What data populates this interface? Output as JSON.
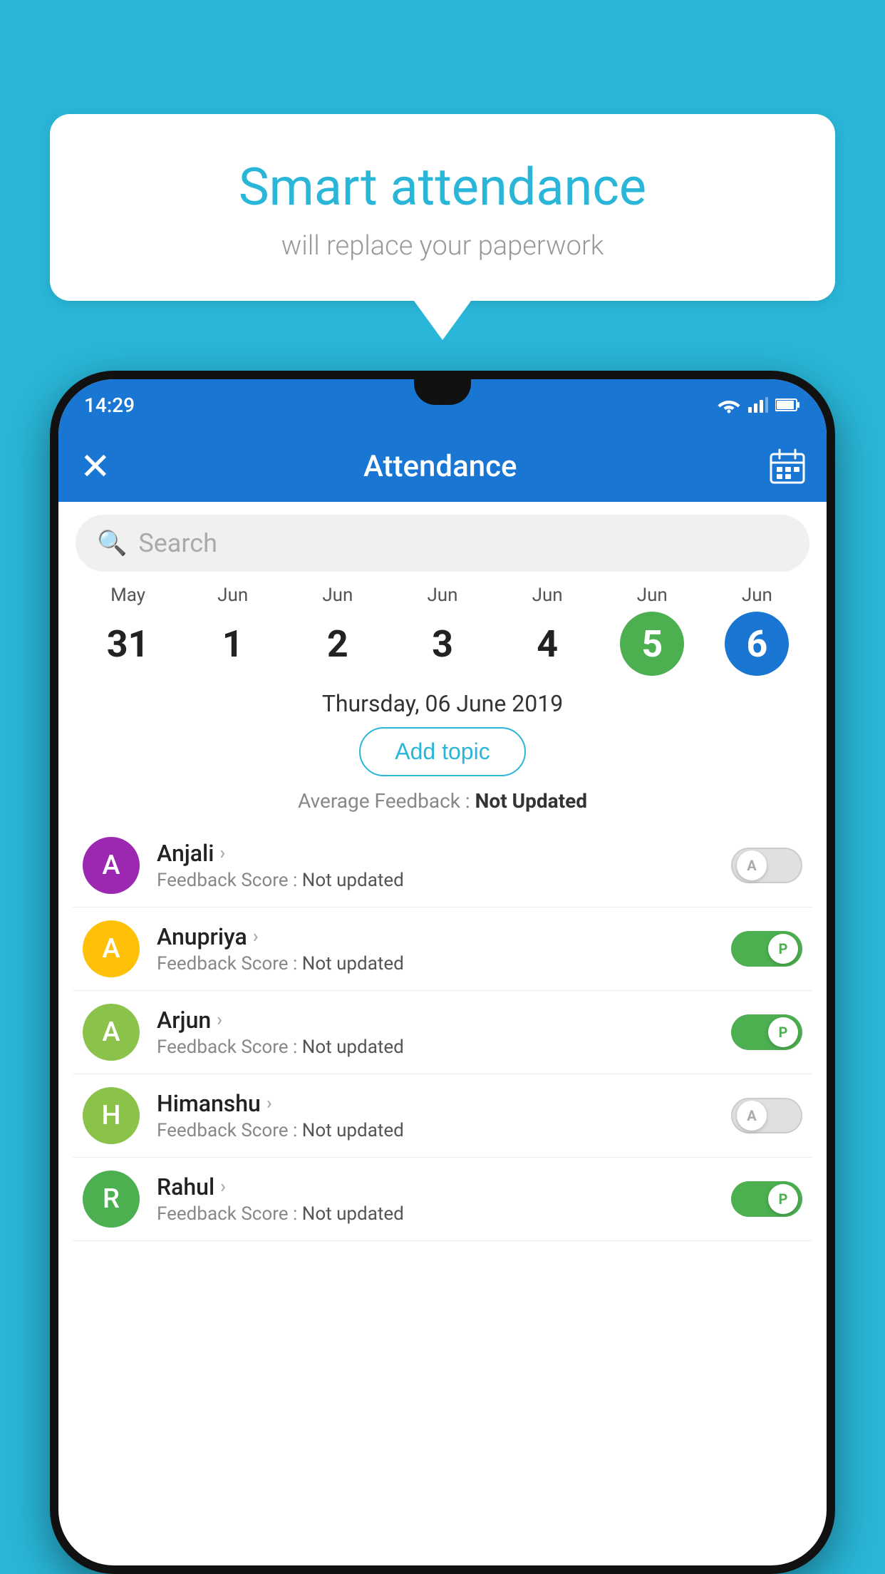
{
  "background_color": "#29b6d8",
  "speech_bubble": {
    "title": "Smart attendance",
    "subtitle": "will replace your paperwork"
  },
  "status_bar": {
    "time": "14:29"
  },
  "app_bar": {
    "close_label": "×",
    "title": "Attendance",
    "calendar_icon": "calendar"
  },
  "search": {
    "placeholder": "Search"
  },
  "calendar": {
    "days": [
      {
        "month": "May",
        "num": "31",
        "state": "normal"
      },
      {
        "month": "Jun",
        "num": "1",
        "state": "normal"
      },
      {
        "month": "Jun",
        "num": "2",
        "state": "normal"
      },
      {
        "month": "Jun",
        "num": "3",
        "state": "normal"
      },
      {
        "month": "Jun",
        "num": "4",
        "state": "normal"
      },
      {
        "month": "Jun",
        "num": "5",
        "state": "today"
      },
      {
        "month": "Jun",
        "num": "6",
        "state": "selected"
      }
    ]
  },
  "selected_date": "Thursday, 06 June 2019",
  "add_topic_label": "Add topic",
  "avg_feedback_label": "Average Feedback :",
  "avg_feedback_value": "Not Updated",
  "students": [
    {
      "name": "Anjali",
      "initial": "A",
      "avatar_color": "#9c27b0",
      "feedback_label": "Feedback Score :",
      "feedback_value": "Not updated",
      "toggle_state": "off",
      "toggle_letter": "A"
    },
    {
      "name": "Anupriya",
      "initial": "A",
      "avatar_color": "#ffc107",
      "feedback_label": "Feedback Score :",
      "feedback_value": "Not updated",
      "toggle_state": "on",
      "toggle_letter": "P"
    },
    {
      "name": "Arjun",
      "initial": "A",
      "avatar_color": "#8bc34a",
      "feedback_label": "Feedback Score :",
      "feedback_value": "Not updated",
      "toggle_state": "on",
      "toggle_letter": "P"
    },
    {
      "name": "Himanshu",
      "initial": "H",
      "avatar_color": "#8bc34a",
      "feedback_label": "Feedback Score :",
      "feedback_value": "Not updated",
      "toggle_state": "off",
      "toggle_letter": "A"
    },
    {
      "name": "Rahul",
      "initial": "R",
      "avatar_color": "#4caf50",
      "feedback_label": "Feedback Score :",
      "feedback_value": "Not updated",
      "toggle_state": "on",
      "toggle_letter": "P"
    }
  ]
}
